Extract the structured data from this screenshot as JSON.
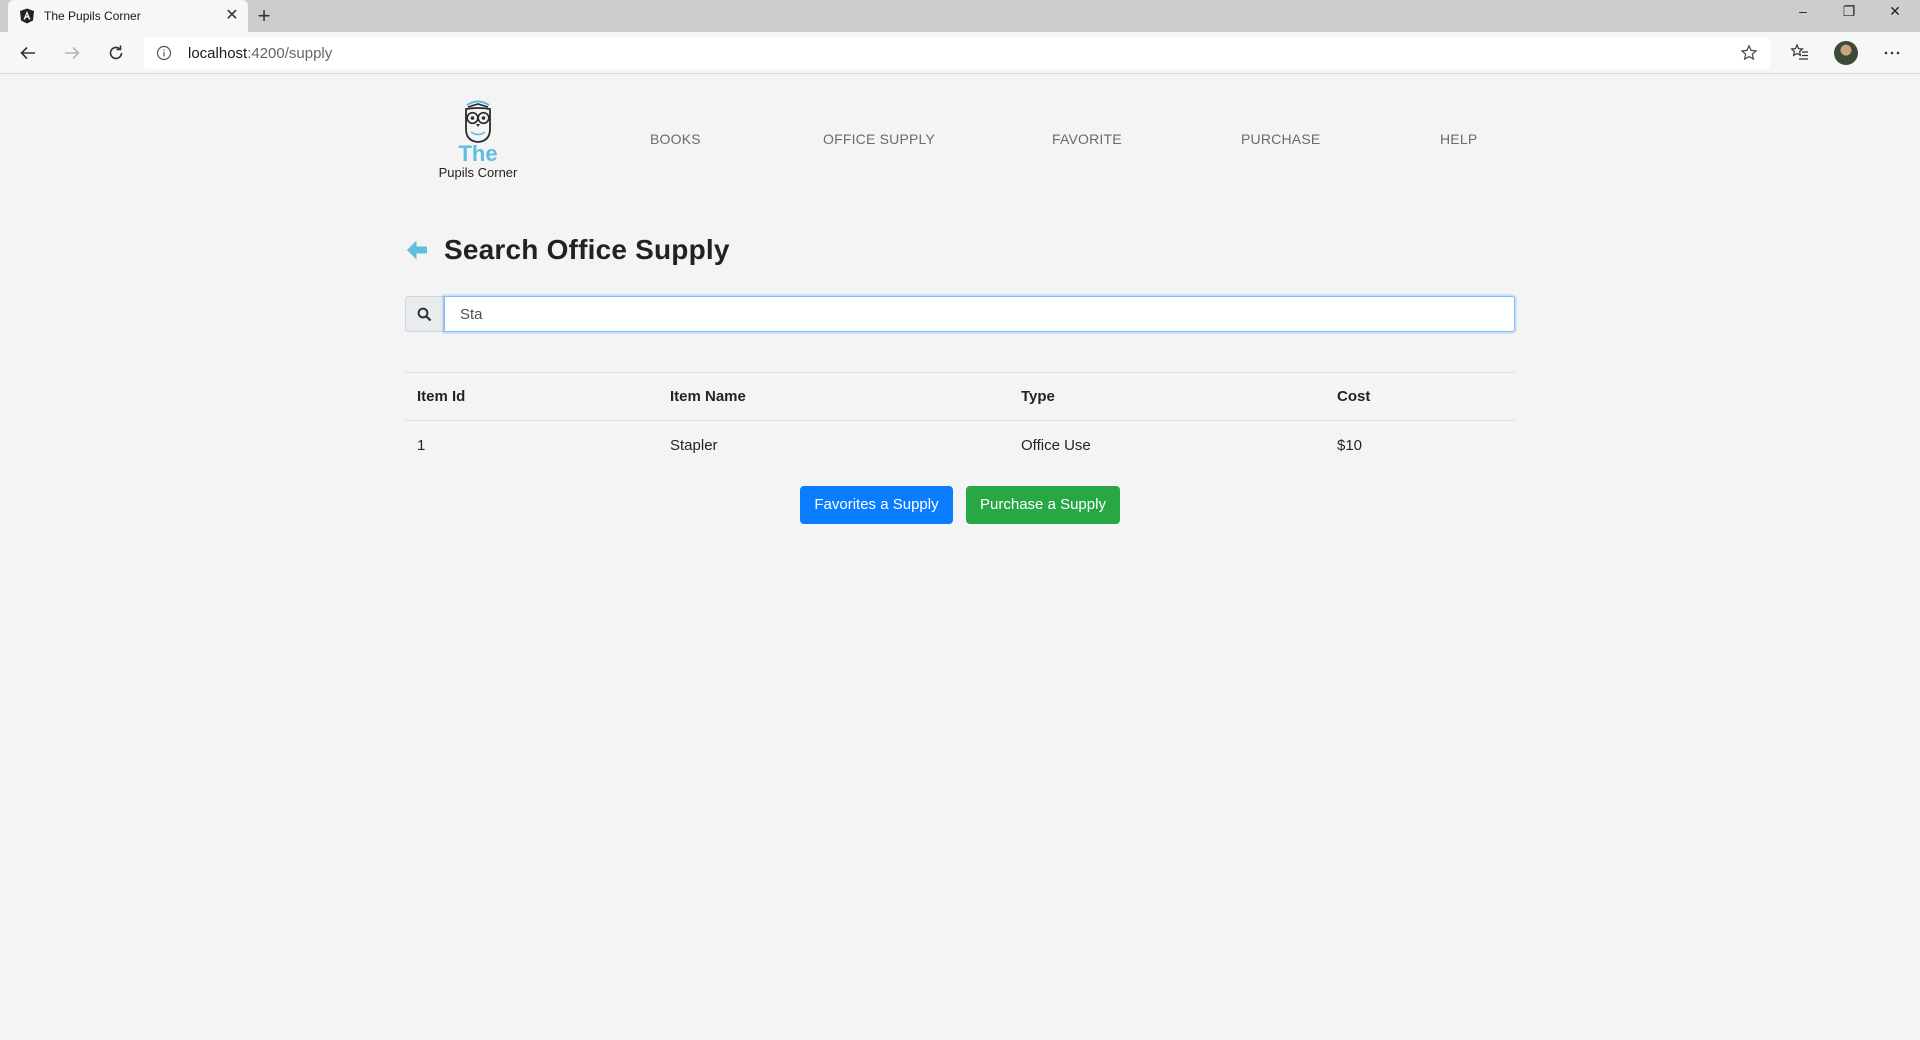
{
  "browser": {
    "tab_title": "The Pupils Corner",
    "tab_icon": "angular-icon",
    "new_tab_label": "+",
    "close_tab_label": "✕",
    "url_host": "localhost",
    "url_path": ":4200/supply",
    "window_controls": {
      "minimize": "–",
      "restore": "❐",
      "close": "✕"
    }
  },
  "logo": {
    "line1": "The",
    "line2": "Pupils Corner",
    "accent_color": "#5fbde0"
  },
  "nav": {
    "books": "BOOKS",
    "office_supply": "OFFICE SUPPLY",
    "favorite": "FAVORITE",
    "purchase": "PURCHASE",
    "help": "HELP"
  },
  "page": {
    "title": "Search Office Supply",
    "back_icon": "arrow-left-icon"
  },
  "search": {
    "value": "Sta",
    "icon": "search-icon"
  },
  "table": {
    "headers": [
      "Item Id",
      "Item Name",
      "Type",
      "Cost"
    ],
    "rows": [
      [
        "1",
        "Stapler",
        "Office Use",
        "$10"
      ]
    ]
  },
  "actions": {
    "favorite_label": "Favorites a Supply",
    "purchase_label": "Purchase a Supply",
    "favorite_color": "#0a7cff",
    "purchase_color": "#28a745"
  }
}
